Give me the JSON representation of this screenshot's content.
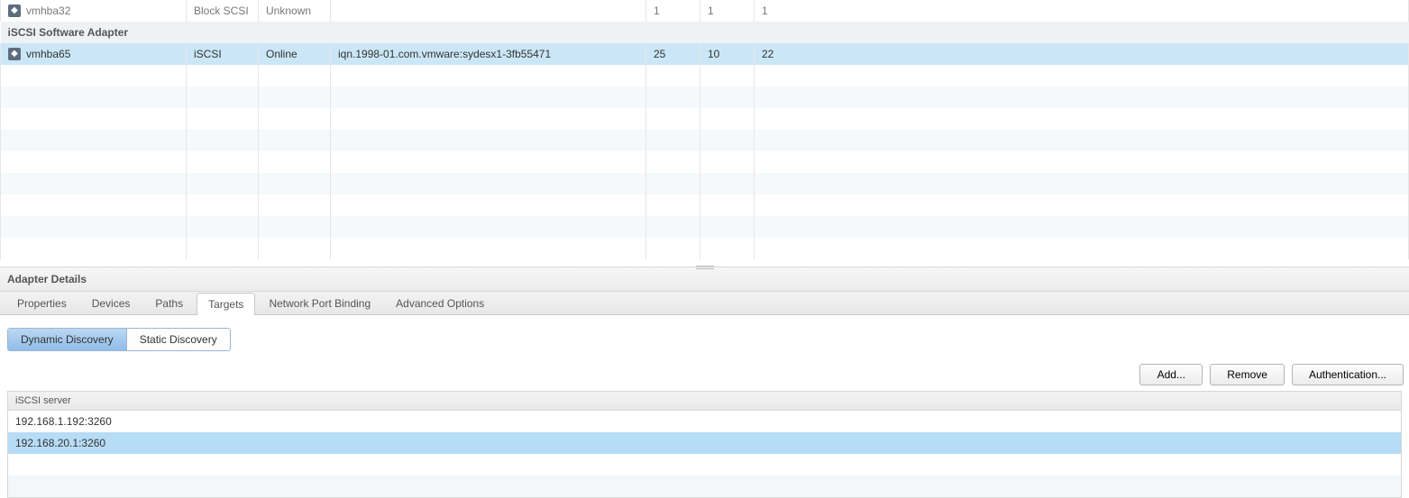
{
  "adapters": {
    "row_cut": {
      "name": "vmhba32",
      "type": "Block SCSI",
      "status": "Unknown",
      "id": "",
      "c4": "1",
      "c5": "1",
      "c6": "1"
    },
    "group_label": "iSCSI Software Adapter",
    "row_sel": {
      "name": "vmhba65",
      "type": "iSCSI",
      "status": "Online",
      "id": "iqn.1998-01.com.vmware:sydesx1-3fb55471",
      "c4": "25",
      "c5": "10",
      "c6": "22"
    }
  },
  "details": {
    "title": "Adapter Details"
  },
  "tabs": {
    "properties": "Properties",
    "devices": "Devices",
    "paths": "Paths",
    "targets": "Targets",
    "npb": "Network Port Binding",
    "adv": "Advanced Options"
  },
  "disc": {
    "dynamic": "Dynamic Discovery",
    "static": "Static Discovery"
  },
  "actions": {
    "add": "Add...",
    "remove": "Remove",
    "auth": "Authentication..."
  },
  "targets_table": {
    "header": "iSCSI server",
    "rows": [
      {
        "addr": "192.168.1.192:3260",
        "selected": false
      },
      {
        "addr": "192.168.20.1:3260",
        "selected": true
      }
    ]
  },
  "icons": {
    "adapter": "◆"
  }
}
